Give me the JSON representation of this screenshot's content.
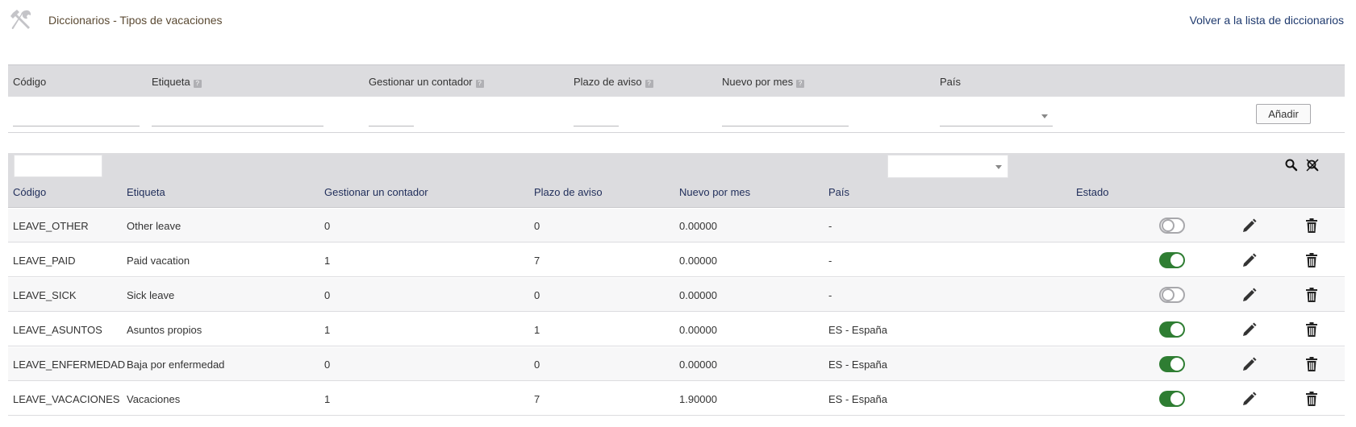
{
  "header": {
    "title": "Diccionarios - Tipos de vacaciones",
    "back_link": "Volver a la lista de diccionarios",
    "icon": "tools-icon"
  },
  "add_form": {
    "columns": {
      "code": "Código",
      "label": "Etiqueta",
      "counter": "Gestionar un contador",
      "notice": "Plazo de aviso",
      "monthly": "Nuevo por mes",
      "country": "País"
    },
    "help_mark": "?",
    "values": {
      "code": "",
      "label": "",
      "counter": "",
      "notice": "",
      "monthly": "",
      "country": ""
    },
    "add_button": "Añadir"
  },
  "filters": {
    "code": "",
    "country": ""
  },
  "table": {
    "headers": {
      "code": "Código",
      "label": "Etiqueta",
      "counter": "Gestionar un contador",
      "notice": "Plazo de aviso",
      "monthly": "Nuevo por mes",
      "country": "País",
      "status": "Estado"
    },
    "rows": [
      {
        "code": "LEAVE_OTHER",
        "label": "Other leave",
        "counter": "0",
        "notice": "0",
        "monthly": "0.00000",
        "country": "-",
        "active": false
      },
      {
        "code": "LEAVE_PAID",
        "label": "Paid vacation",
        "counter": "1",
        "notice": "7",
        "monthly": "0.00000",
        "country": "-",
        "active": true
      },
      {
        "code": "LEAVE_SICK",
        "label": "Sick leave",
        "counter": "0",
        "notice": "0",
        "monthly": "0.00000",
        "country": "-",
        "active": false
      },
      {
        "code": "LEAVE_ASUNTOS",
        "label": "Asuntos propios",
        "counter": "1",
        "notice": "1",
        "monthly": "0.00000",
        "country": "ES - España",
        "active": true
      },
      {
        "code": "LEAVE_ENFERMEDAD",
        "label": "Baja por enfermedad",
        "counter": "0",
        "notice": "0",
        "monthly": "0.00000",
        "country": "ES - España",
        "active": true
      },
      {
        "code": "LEAVE_VACACIONES",
        "label": "Vacaciones",
        "counter": "1",
        "notice": "7",
        "monthly": "1.90000",
        "country": "ES - España",
        "active": true
      }
    ]
  },
  "colors": {
    "toggle_on": "#2e7d32",
    "header_bg": "#dcdcdf",
    "link": "#1f3a6e"
  }
}
